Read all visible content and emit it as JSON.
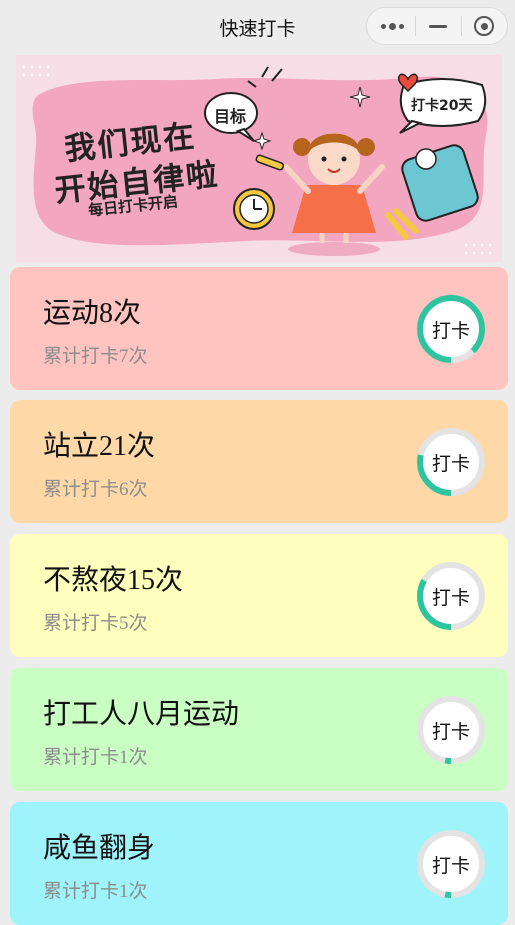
{
  "navbar": {
    "title": "快速打卡",
    "more_icon": "more-dots-icon",
    "minimize_icon": "minimize-icon",
    "close_icon": "target-close-icon"
  },
  "banner": {
    "headline_line1": "我们现在",
    "headline_line2": "开始自律啦",
    "tagline": "每日打卡开启",
    "bubble_goal": "目标",
    "bubble_days": "打卡20天"
  },
  "colors": {
    "ring_progress": "#2fc4a0",
    "ring_track": "#e3e3e3"
  },
  "cards": [
    {
      "title": "运动8次",
      "subtitle": "累计打卡7次",
      "button": "打卡",
      "progress": 0.875,
      "bg": "#ffc4c0"
    },
    {
      "title": "站立21次",
      "subtitle": "累计打卡6次",
      "button": "打卡",
      "progress": 0.2857,
      "bg": "#ffd8a8"
    },
    {
      "title": "不熬夜15次",
      "subtitle": "累计打卡5次",
      "button": "打卡",
      "progress": 0.3333,
      "bg": "#ffffbd"
    },
    {
      "title": "打工人八月运动",
      "subtitle": "累计打卡1次",
      "button": "打卡",
      "progress": 0.03,
      "bg": "#caffc4"
    },
    {
      "title": "咸鱼翻身",
      "subtitle": "累计打卡1次",
      "button": "打卡",
      "progress": 0.03,
      "bg": "#9ff3fb"
    }
  ]
}
